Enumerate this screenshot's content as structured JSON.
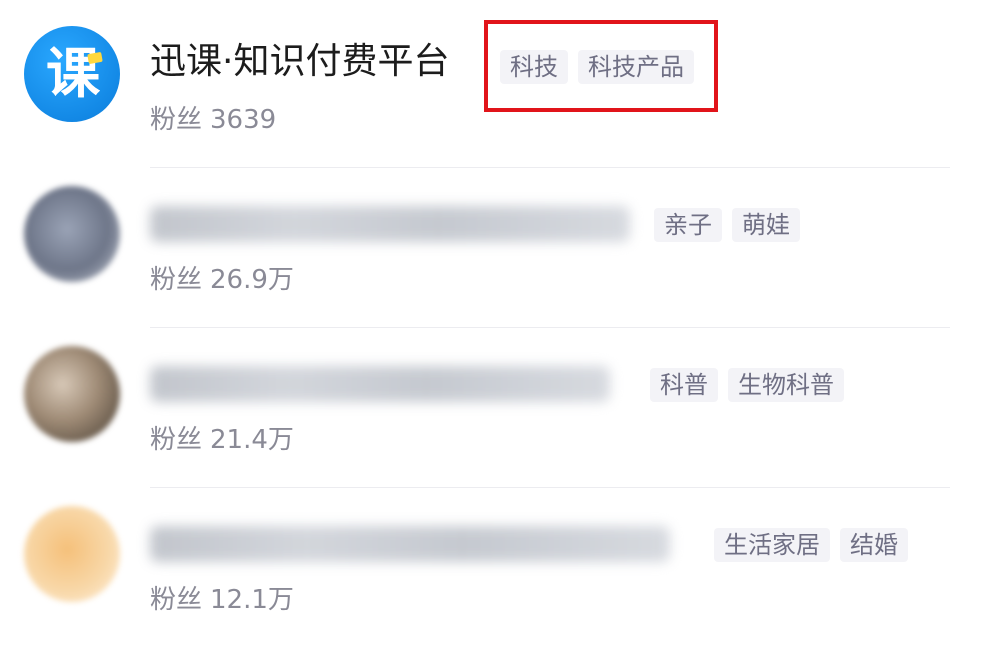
{
  "items": [
    {
      "title": "迅课·知识付费平台",
      "avatar_glyph": "课",
      "tags": [
        "科技",
        "科技产品"
      ],
      "fans_label": "粉丝",
      "fans_value": "3639"
    },
    {
      "title": "",
      "tags": [
        "亲子",
        "萌娃"
      ],
      "fans_label": "粉丝",
      "fans_value": "26.9万"
    },
    {
      "title": "",
      "tags": [
        "科普",
        "生物科普"
      ],
      "fans_label": "粉丝",
      "fans_value": "21.4万"
    },
    {
      "title": "",
      "tags": [
        "生活家居",
        "结婚"
      ],
      "fans_label": "粉丝",
      "fans_value": "12.1万"
    }
  ],
  "colors": {
    "highlight_box": "#e1141a",
    "brand_avatar": "#1389e6",
    "tag_background": "#f3f3f7",
    "tag_text": "#6f6f84",
    "fans_text": "#8a8a96"
  },
  "icons": {
    "brand_avatar": "xunke-logo-icon"
  }
}
